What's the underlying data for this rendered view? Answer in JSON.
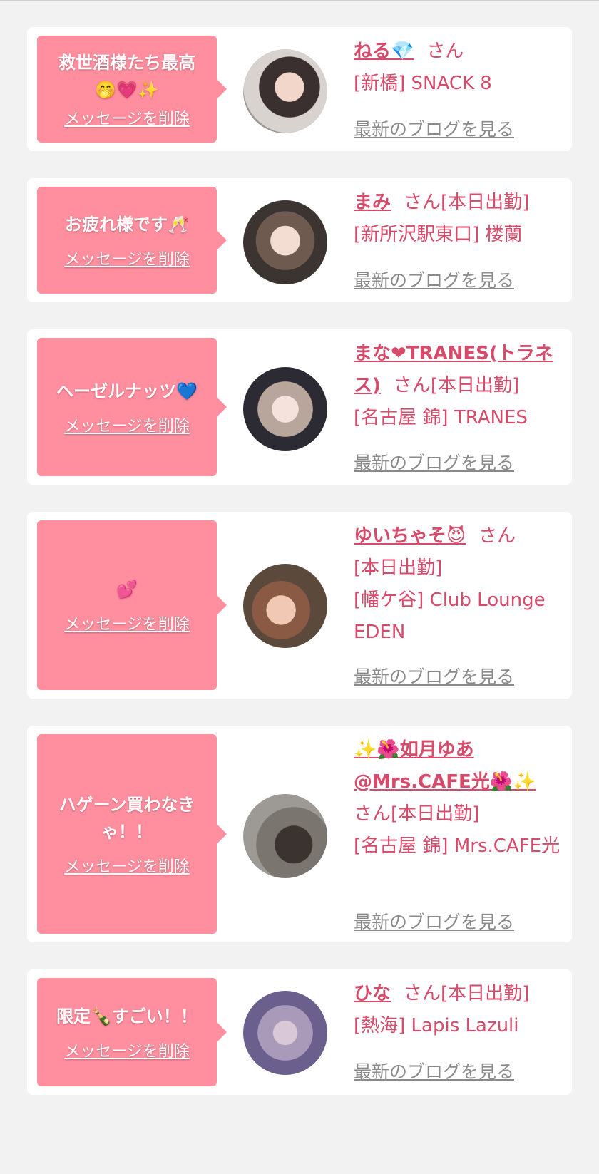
{
  "san": "さん",
  "delete_label": "メッセージを削除",
  "blog_label": "最新のブログを見る",
  "cards": [
    {
      "message": "救世酒様たち最高",
      "message_emoji": "🤭💗✨",
      "name": "ねる💎",
      "status": "",
      "shop": "[新橋] SNACK 8"
    },
    {
      "message": "お疲れ様です🥂",
      "message_emoji": "",
      "name": "まみ",
      "status": "[本日出勤]",
      "shop": "[新所沢駅東口] 楼蘭"
    },
    {
      "message": "ヘーゼルナッツ💙",
      "message_emoji": "",
      "name": "まな❤TRANES(トラネス)",
      "status": "[本日出勤]",
      "shop": "[名古屋 錦] TRANES"
    },
    {
      "message": "",
      "message_emoji": "💕",
      "name": "ゆいちゃそ😈",
      "status": "[本日出勤]",
      "shop": "[幡ケ谷] Club Lounge EDEN"
    },
    {
      "message": "ハゲーン買わなきゃ！！",
      "message_emoji": "",
      "name": "✨🌺如月ゆあ@Mrs.CAFE光🌺✨",
      "status": "[本日出勤]",
      "shop": "[名古屋 錦] Mrs.CAFE光"
    },
    {
      "message": "限定🍾すごい！！",
      "message_emoji": "",
      "name": "ひな",
      "status": "[本日出勤]",
      "shop": "[熱海] Lapis Lazuli"
    }
  ]
}
